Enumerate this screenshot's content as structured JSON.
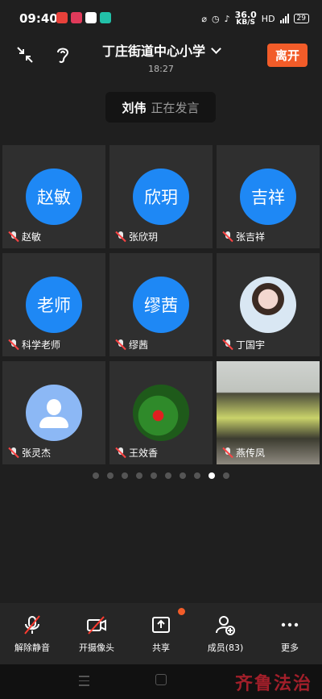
{
  "status_bar": {
    "time": "09:40",
    "network_speed": "36.0",
    "network_unit": "KB/S",
    "hd": "HD",
    "battery": "29"
  },
  "header": {
    "meeting_title": "丁庄街道中心小学",
    "duration": "18:27",
    "leave_label": "离开"
  },
  "speaker": {
    "name": "刘伟",
    "status": "正在发言"
  },
  "participants": [
    {
      "avatar_text": "赵敏",
      "name": "赵敏"
    },
    {
      "avatar_text": "欣玥",
      "name": "张欣玥"
    },
    {
      "avatar_text": "吉祥",
      "name": "张吉祥"
    },
    {
      "avatar_text": "老师",
      "name": "科学老师"
    },
    {
      "avatar_text": "缪茜",
      "name": "缪茜"
    },
    {
      "avatar_text": "",
      "name": "丁国宇"
    },
    {
      "avatar_text": "",
      "name": "张灵杰"
    },
    {
      "avatar_text": "",
      "name": "王效香"
    },
    {
      "avatar_text": "",
      "name": "燕传凤"
    }
  ],
  "pagination": {
    "total": 10,
    "active_index": 8
  },
  "toolbar": {
    "unmute": "解除静音",
    "camera": "开摄像头",
    "share": "共享",
    "members": "成员(83)",
    "more": "更多"
  },
  "watermark": "齐鲁法治",
  "colors": {
    "accent": "#f25c29",
    "avatar_blue": "#1e88f5",
    "tile_bg": "#2f2f2f"
  }
}
